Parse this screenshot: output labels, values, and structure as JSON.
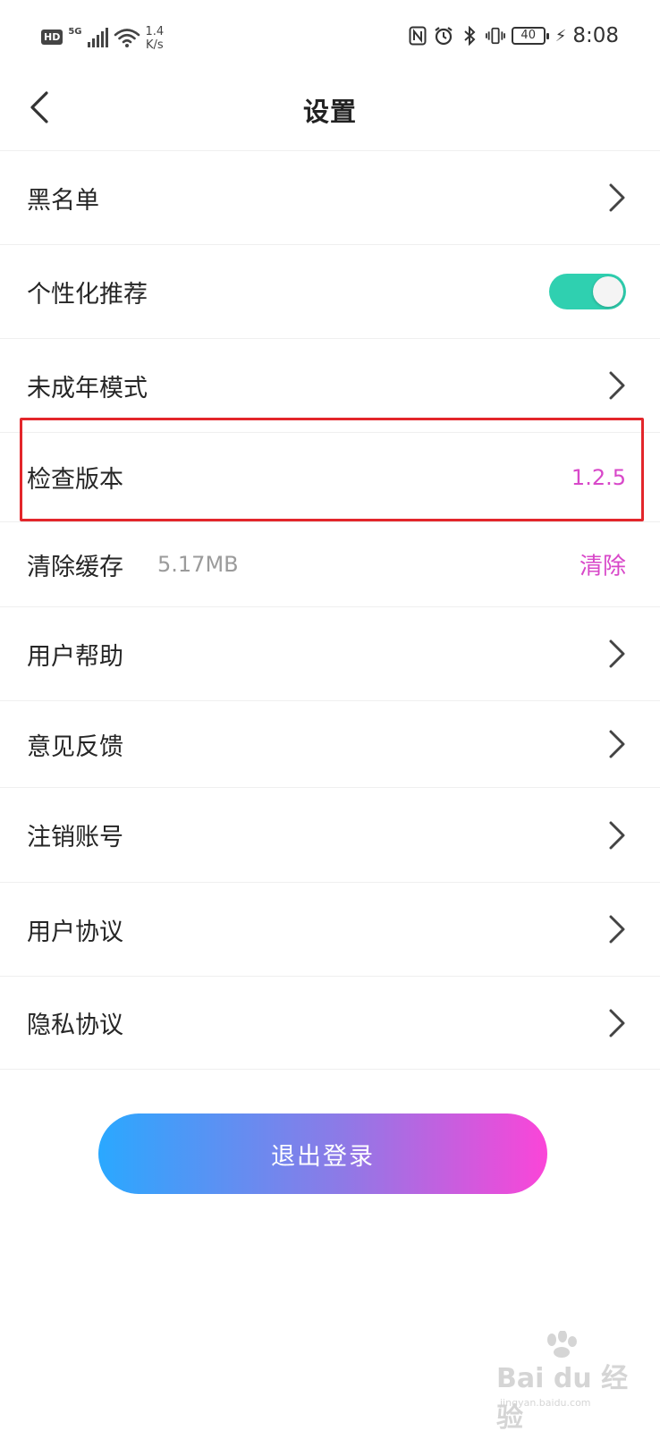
{
  "status_bar": {
    "hd": "HD",
    "network": "5G",
    "speed_value": "1.4",
    "speed_unit": "K/s",
    "battery": "40",
    "time": "8:08"
  },
  "header": {
    "title": "设置"
  },
  "settings": {
    "blacklist": "黑名单",
    "personalized": "个性化推荐",
    "personalized_enabled": true,
    "minor_mode": "未成年模式",
    "check_version": "检查版本",
    "version_value": "1.2.5",
    "clear_cache": "清除缓存",
    "cache_size": "5.17MB",
    "clear_action": "清除",
    "user_help": "用户帮助",
    "feedback": "意见反馈",
    "deactivate": "注销账号",
    "user_agreement": "用户协议",
    "privacy_agreement": "隐私协议"
  },
  "logout": {
    "label": "退出登录"
  },
  "watermark": {
    "text": "Bai du 经验",
    "sub": "jingyan.baidu.com"
  },
  "colors": {
    "accent": "#d848c9",
    "toggle_on": "#2fd0b0",
    "highlight_box": "#e3262b",
    "gradient_start": "#2aa8ff",
    "gradient_end": "#fb45d8"
  }
}
